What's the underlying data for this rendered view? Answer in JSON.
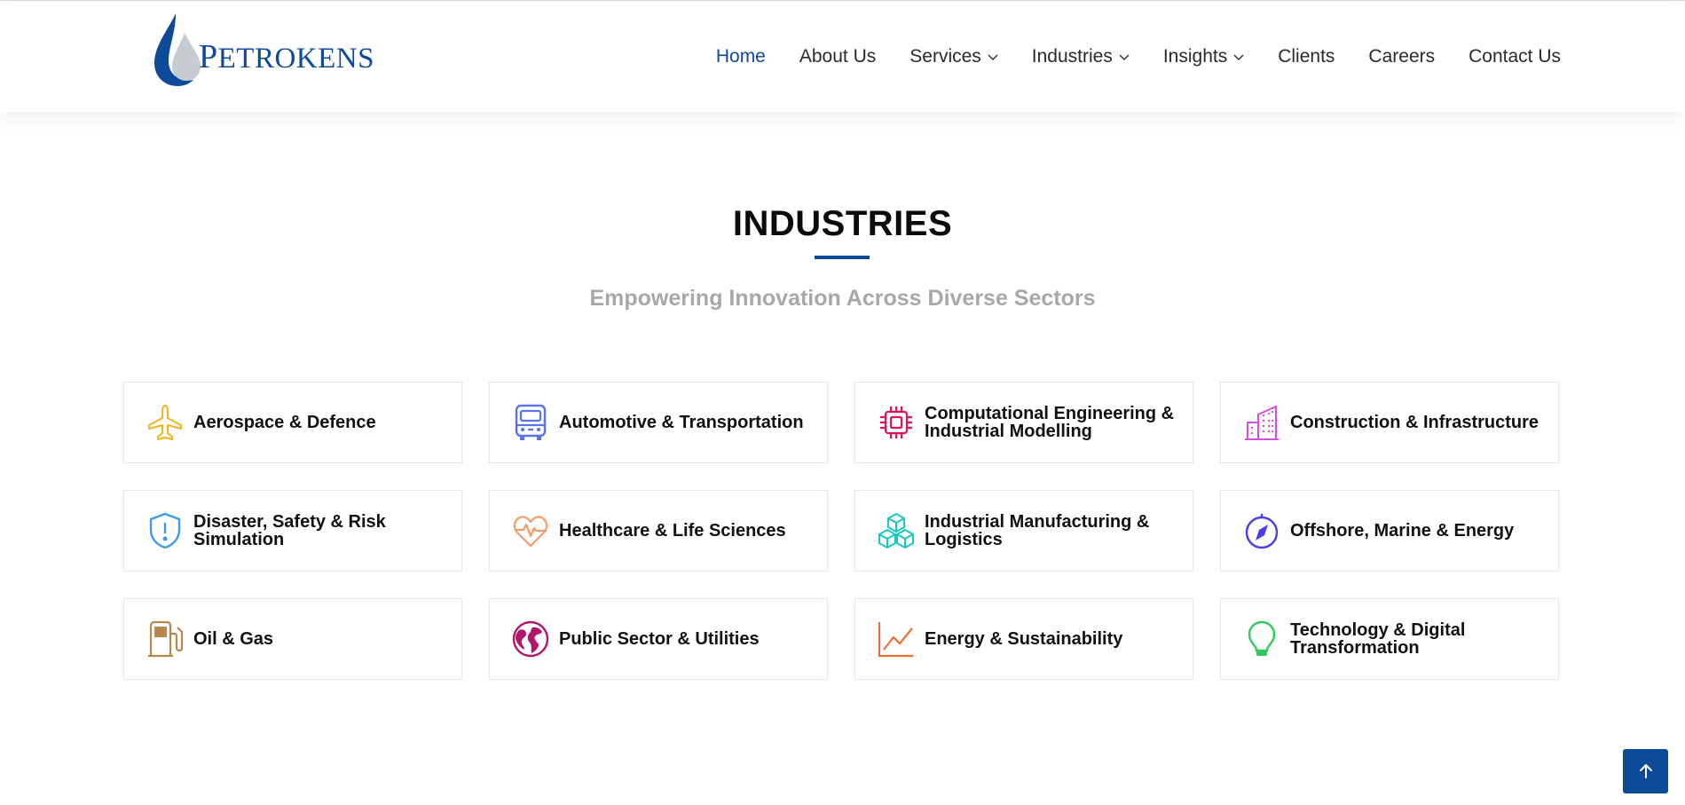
{
  "brand": {
    "logo_text_initial": "P",
    "logo_text_rest": "ETROKENS",
    "primary_color": "#0d4a99"
  },
  "nav": {
    "items": [
      {
        "label": "Home",
        "active": true,
        "dropdown": false
      },
      {
        "label": "About Us",
        "active": false,
        "dropdown": false
      },
      {
        "label": "Services",
        "active": false,
        "dropdown": true
      },
      {
        "label": "Industries",
        "active": false,
        "dropdown": true
      },
      {
        "label": "Insights",
        "active": false,
        "dropdown": true
      },
      {
        "label": "Clients",
        "active": false,
        "dropdown": false
      },
      {
        "label": "Careers",
        "active": false,
        "dropdown": false
      },
      {
        "label": "Contact Us",
        "active": false,
        "dropdown": false
      }
    ]
  },
  "section": {
    "title": "INDUSTRIES",
    "subtitle": "Empowering Innovation Across Diverse Sectors"
  },
  "industries": [
    {
      "label": "Aerospace & Defence",
      "icon": "airplane-icon",
      "color": "#f5b21b"
    },
    {
      "label": "Automotive & Transportation",
      "icon": "bus-icon",
      "color": "#5c72e8"
    },
    {
      "label": "Computational Engineering & Industrial Modelling",
      "icon": "cpu-chip-icon",
      "color": "#e0115f"
    },
    {
      "label": "Construction & Infrastructure",
      "icon": "building-icon",
      "color": "#d64ee0"
    },
    {
      "label": "Disaster, Safety & Risk Simulation",
      "icon": "shield-alert-icon",
      "color": "#3d9be9"
    },
    {
      "label": "Healthcare & Life Sciences",
      "icon": "heart-pulse-icon",
      "color": "#f59b68"
    },
    {
      "label": "Industrial Manufacturing & Logistics",
      "icon": "boxes-icon",
      "color": "#19c7c0"
    },
    {
      "label": "Offshore, Marine & Energy",
      "icon": "compass-icon",
      "color": "#4a3af0"
    },
    {
      "label": "Oil & Gas",
      "icon": "fuel-pump-icon",
      "color": "#b5894a"
    },
    {
      "label": "Public Sector & Utilities",
      "icon": "globe-icon",
      "color": "#b0166b"
    },
    {
      "label": "Energy & Sustainability",
      "icon": "line-chart-icon",
      "color": "#ee6b33"
    },
    {
      "label": "Technology & Digital Transformation",
      "icon": "lightbulb-icon",
      "color": "#2fc95a"
    }
  ],
  "scroll_top": {
    "icon": "arrow-up-icon"
  }
}
